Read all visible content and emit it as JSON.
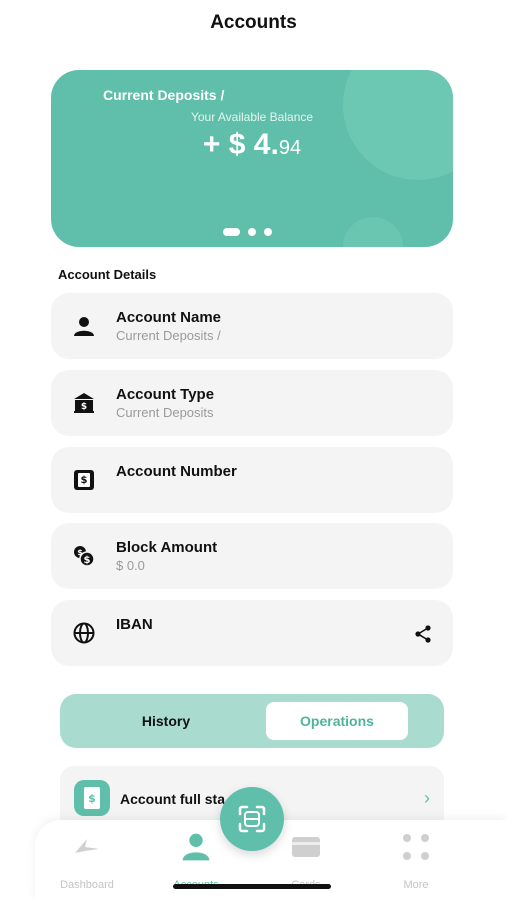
{
  "header": {
    "title": "Accounts"
  },
  "balance_card": {
    "title": "Current Deposits /",
    "subtitle": "Your Available Balance",
    "balance_main": "+ $ 4.",
    "balance_fraction": "94",
    "pager": {
      "count": 3,
      "active_index": 0
    }
  },
  "account_details": {
    "heading": "Account Details",
    "rows": [
      {
        "label": "Account Name",
        "value": "Current Deposits /",
        "icon": "person-icon"
      },
      {
        "label": "Account Type",
        "value": "Current Deposits",
        "icon": "bank-icon"
      },
      {
        "label": "Account Number",
        "value": "",
        "icon": "account-number-icon"
      },
      {
        "label": "Block Amount",
        "value": "$ 0.0",
        "icon": "coins-icon"
      },
      {
        "label": "IBAN",
        "value": "",
        "icon": "globe-icon",
        "trailing_icon": "share-icon"
      }
    ]
  },
  "segmented": {
    "history": "History",
    "operations": "Operations",
    "selected": "operations"
  },
  "statement": {
    "label": "Account full sta",
    "icon": "statement-icon",
    "chevron": "›"
  },
  "bottom_nav": {
    "items": [
      {
        "label": "Dashboard",
        "icon": "dashboard-icon"
      },
      {
        "label": "Accounts",
        "icon": "person-icon",
        "active": true
      },
      {
        "label": "Cards",
        "icon": "card-icon"
      },
      {
        "label": "More",
        "icon": "grid-icon"
      }
    ],
    "center_button_icon": "scan-icon"
  },
  "colors": {
    "accent": "#5fbfaa",
    "accent_light": "#a9dccf",
    "row_bg": "#f4f4f4"
  }
}
